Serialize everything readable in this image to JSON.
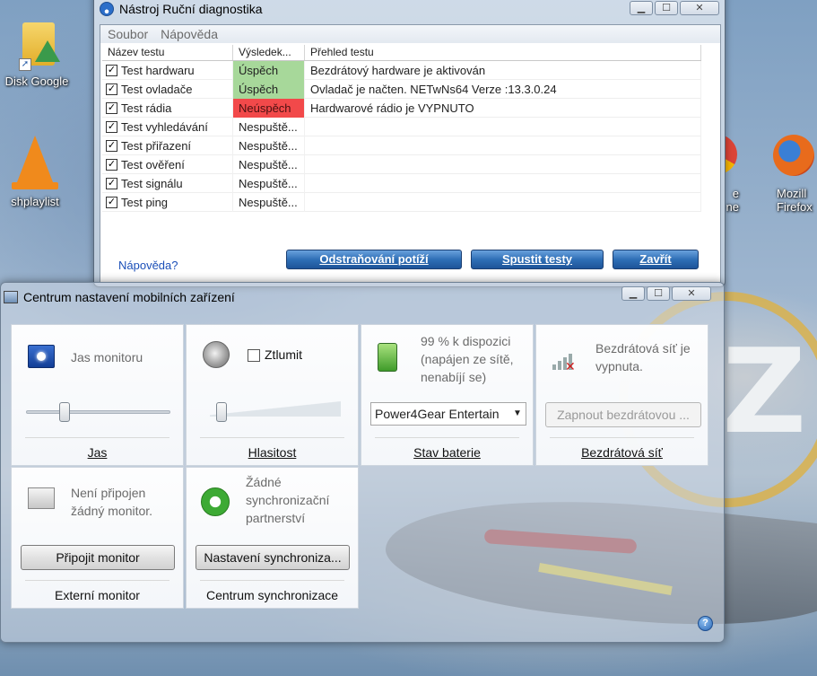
{
  "desktop": {
    "icons": [
      {
        "label": "Disk Google",
        "icon": "google-drive-icon"
      },
      {
        "label": "shplaylist",
        "icon": "vlc-icon"
      },
      {
        "label": "e\nne",
        "icon": "chrome-icon"
      },
      {
        "label": "Mozill\nFirefox",
        "icon": "firefox-icon"
      }
    ]
  },
  "diag": {
    "title": "Nástroj Ruční diagnostika",
    "menu": [
      "Soubor",
      "Nápověda"
    ],
    "columns": [
      "Název testu",
      "Výsledek...",
      "Přehled testu"
    ],
    "rows": [
      {
        "name": "Test hardwaru",
        "result": "Úspěch",
        "status": "ok",
        "summary": "Bezdrátový hardware je aktivován"
      },
      {
        "name": "Test ovladače",
        "result": "Úspěch",
        "status": "ok",
        "summary": "Ovladač je načten. NETwNs64 Verze :13.3.0.24"
      },
      {
        "name": "Test rádia",
        "result": "Neúspěch",
        "status": "fail",
        "summary": "Hardwarové rádio je VYPNUTO"
      },
      {
        "name": "Test vyhledávání",
        "result": "Nespuště...",
        "status": "none",
        "summary": ""
      },
      {
        "name": "Test přiřazení",
        "result": "Nespuště...",
        "status": "none",
        "summary": ""
      },
      {
        "name": "Test ověření",
        "result": "Nespuště...",
        "status": "none",
        "summary": ""
      },
      {
        "name": "Test signálu",
        "result": "Nespuště...",
        "status": "none",
        "summary": ""
      },
      {
        "name": "Test ping",
        "result": "Nespuště...",
        "status": "none",
        "summary": ""
      }
    ],
    "help_link": "Nápověda?",
    "buttons": {
      "troubleshoot": "Odstraňování potíží",
      "run": "Spustit testy",
      "close": "Zavřít"
    }
  },
  "mobility": {
    "title": "Centrum nastavení mobilních zařízení",
    "brightness": {
      "text": "Jas monitoru",
      "label": "Jas",
      "level": 0.25
    },
    "volume": {
      "mute_label": "Ztlumit",
      "label": "Hlasitost",
      "level": 0.05,
      "muted": false
    },
    "battery": {
      "text": "99 % k dispozici (napájen ze sítě, nenabíjí se)",
      "plan": "Power4Gear Entertain",
      "label": "Stav baterie"
    },
    "wireless": {
      "text": "Bezdrátová síť je vypnuta.",
      "button": "Zapnout bezdrátovou ...",
      "label": "Bezdrátová síť"
    },
    "monitor": {
      "text": "Není připojen žádný monitor.",
      "button": "Připojit monitor",
      "label": "Externí monitor"
    },
    "sync": {
      "text": "Žádné synchronizační partnerství",
      "button": "Nastavení synchroniza...",
      "label": "Centrum synchronizace"
    }
  }
}
